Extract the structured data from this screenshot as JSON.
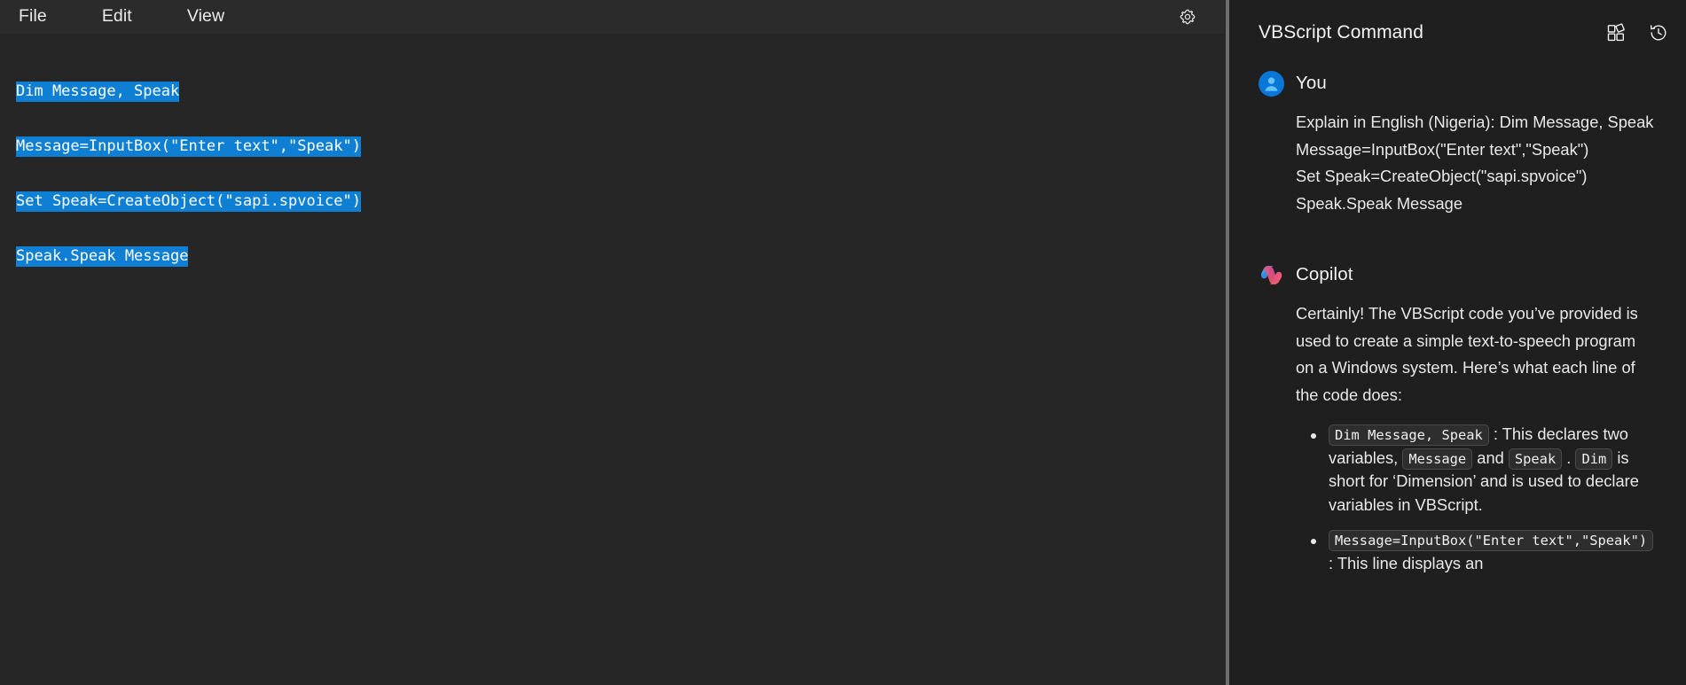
{
  "editor": {
    "menu": [
      {
        "label": "File",
        "name": "menu-file"
      },
      {
        "label": "Edit",
        "name": "menu-edit"
      },
      {
        "label": "View",
        "name": "menu-view"
      }
    ],
    "settings_icon": "gear-icon",
    "code_lines": [
      "Dim Message, Speak",
      "Message=InputBox(\"Enter text\",\"Speak\")",
      "Set Speak=CreateObject(\"sapi.spvoice\")",
      "Speak.Speak Message"
    ],
    "selection_color": "#0f7fd4",
    "background_color": "#262626"
  },
  "chat": {
    "title": "VBScript Command",
    "header_icons": [
      {
        "name": "apps-grid-icon",
        "label": "Plugins"
      },
      {
        "name": "history-icon",
        "label": "History"
      }
    ],
    "messages": [
      {
        "author": "You",
        "avatar": "user-avatar-icon",
        "text": "Explain in English (Nigeria): Dim Message, Speak\nMessage=InputBox(\"Enter text\",\"Speak\")\nSet Speak=CreateObject(\"sapi.spvoice\")\nSpeak.Speak Message"
      },
      {
        "author": "Copilot",
        "avatar": "copilot-logo-icon",
        "intro": "Certainly! The VBScript code you’ve provided is used to create a simple text-to-speech program on a Windows system. Here’s what each line of the code does:",
        "bullets": [
          {
            "parts": [
              {
                "type": "code",
                "text": "Dim Message, Speak"
              },
              {
                "type": "text",
                "text": " : This declares two variables, "
              },
              {
                "type": "code",
                "text": "Message"
              },
              {
                "type": "text",
                "text": " and "
              },
              {
                "type": "code",
                "text": "Speak"
              },
              {
                "type": "text",
                "text": " . "
              },
              {
                "type": "code",
                "text": "Dim"
              },
              {
                "type": "text",
                "text": " is short for ‘Dimension’ and is used to declare variables in VBScript."
              }
            ]
          },
          {
            "parts": [
              {
                "type": "code",
                "text": "Message=InputBox(\"Enter text\",\"Speak\")"
              },
              {
                "type": "text",
                "text": " : This line displays an"
              }
            ]
          }
        ]
      }
    ],
    "background_color": "#1f1f1f"
  }
}
